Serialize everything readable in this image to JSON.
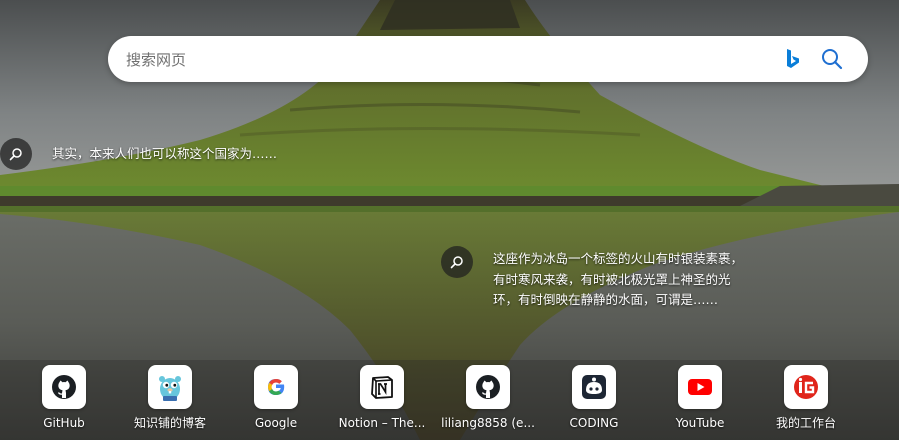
{
  "search": {
    "placeholder": "搜索网页",
    "bing_icon": "bing-logo-icon",
    "search_icon": "magnifier-icon"
  },
  "hotspots": [
    {
      "icon": "magnifier-icon",
      "text": "其实，本来人们也可以称这个国家为……"
    },
    {
      "icon": "magnifier-icon",
      "text": "这座作为冰岛一个标签的火山有时银装素裹，有时寒风来袭，有时被北极光罩上神圣的光环，有时倒映在静静的水面，可谓是……"
    }
  ],
  "shortcuts": [
    {
      "label": "GitHub",
      "icon": "github-icon"
    },
    {
      "label": "知识铺的博客",
      "icon": "gopher-icon"
    },
    {
      "label": "Google",
      "icon": "google-icon"
    },
    {
      "label": "Notion – The...",
      "icon": "notion-icon"
    },
    {
      "label": "liliang8858 (e...",
      "icon": "github-icon"
    },
    {
      "label": "CODING",
      "icon": "coding-icon"
    },
    {
      "label": "YouTube",
      "icon": "youtube-icon"
    },
    {
      "label": "我的工作台",
      "icon": "workbench-icon"
    }
  ],
  "colors": {
    "bing_blue": "#0a7ed8",
    "search_blue": "#1f6fd1",
    "youtube_red": "#ff0000",
    "workbench_red": "#e0251b"
  }
}
